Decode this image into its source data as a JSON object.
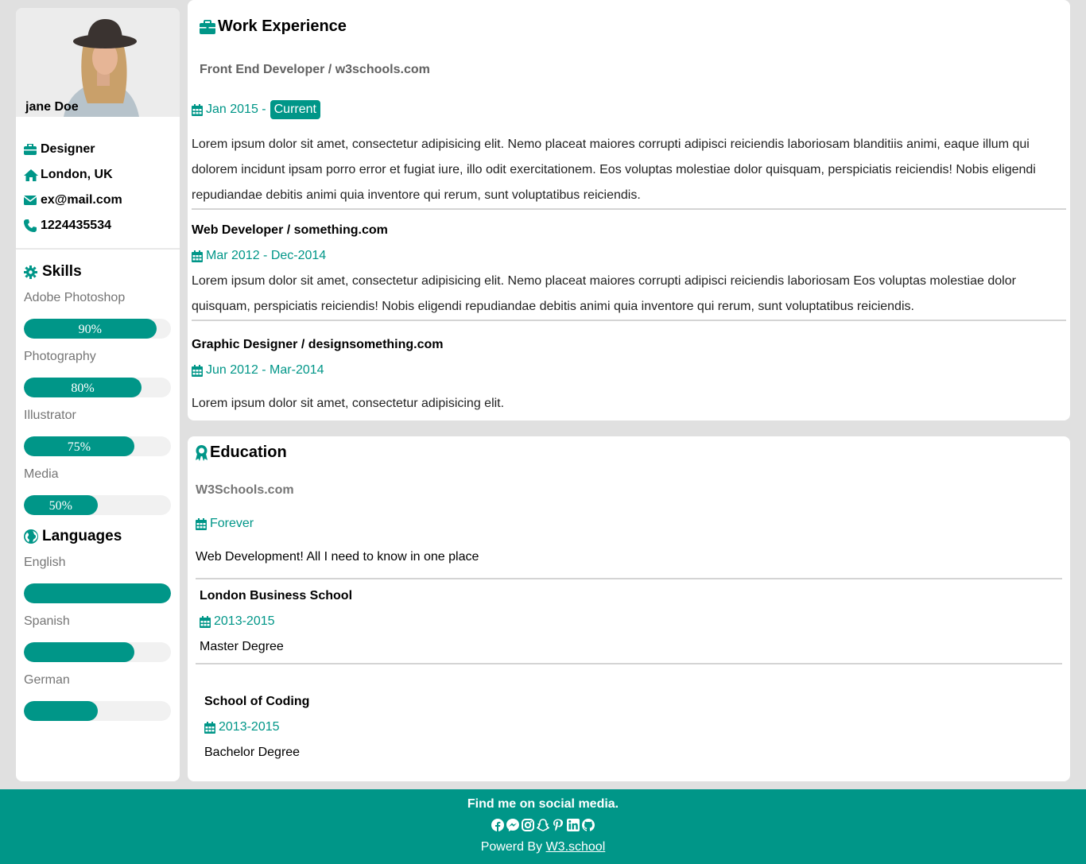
{
  "profile": {
    "name": "jane Doe",
    "info": [
      {
        "icon": "briefcase-icon",
        "text": "Designer"
      },
      {
        "icon": "home-icon",
        "text": "London, UK"
      },
      {
        "icon": "envelope-icon",
        "text": "ex@mail.com"
      },
      {
        "icon": "phone-icon",
        "text": "1224435534"
      }
    ]
  },
  "skills": {
    "title": "Skills",
    "items": [
      {
        "name": "Adobe Photoshop",
        "level": 90,
        "label": "90%"
      },
      {
        "name": "Photography",
        "level": 80,
        "label": "80%"
      },
      {
        "name": "Illustrator",
        "level": 75,
        "label": "75%"
      },
      {
        "name": "Media",
        "level": 50,
        "label": "50%"
      }
    ]
  },
  "languages": {
    "title": "Languages",
    "items": [
      {
        "name": "English",
        "level": 100
      },
      {
        "name": "Spanish",
        "level": 75
      },
      {
        "name": "German",
        "level": 50
      }
    ]
  },
  "work": {
    "title": "Work Experience",
    "jobs": [
      {
        "title": "Front End Developer / w3schools.com",
        "date": "Jan 2015 -",
        "tag": "Current",
        "desc": "Lorem ipsum dolor sit amet, consectetur adipisicing elit. Nemo placeat maiores corrupti adipisci reiciendis laboriosam blanditiis animi, eaque illum qui dolorem incidunt ipsam porro error et fugiat iure, illo odit exercitationem. Eos voluptas molestiae dolor quisquam, perspiciatis reiciendis! Nobis eligendi repudiandae debitis animi quia inventore qui rerum, sunt voluptatibus reiciendis."
      },
      {
        "title": "Web Developer / something.com",
        "date": "Mar 2012 - Dec-2014",
        "desc": "Lorem ipsum dolor sit amet, consectetur adipisicing elit. Nemo placeat maiores corrupti adipisci reiciendis laboriosam Eos voluptas molestiae dolor quisquam, perspiciatis reiciendis! Nobis eligendi repudiandae debitis animi quia inventore qui rerum, sunt voluptatibus reiciendis."
      },
      {
        "title": "Graphic Designer / designsomething.com",
        "date": "Jun 2012 - Mar-2014",
        "desc": "Lorem ipsum dolor sit amet, consectetur adipisicing elit."
      }
    ]
  },
  "education": {
    "title": "Education",
    "items": [
      {
        "school": "W3Schools.com",
        "date": "Forever",
        "desc": "Web Development! All I need to know in one place"
      },
      {
        "school": "London Business School",
        "date": "2013-2015",
        "desc": "Master Degree"
      },
      {
        "school": "School of Coding",
        "date": "2013-2015",
        "desc": "Bachelor Degree"
      }
    ]
  },
  "footer": {
    "title": "Find me on social media.",
    "socials": [
      "facebook-icon",
      "messenger-icon",
      "instagram-icon",
      "snapchat-icon",
      "pinterest-icon",
      "linkedin-icon",
      "github-icon"
    ],
    "powered_prefix": "Powerd By",
    "powered_link": "W3.school"
  },
  "colors": {
    "accent": "#009688",
    "background": "#e0e0e0",
    "bar_track": "#f1f1f1"
  }
}
